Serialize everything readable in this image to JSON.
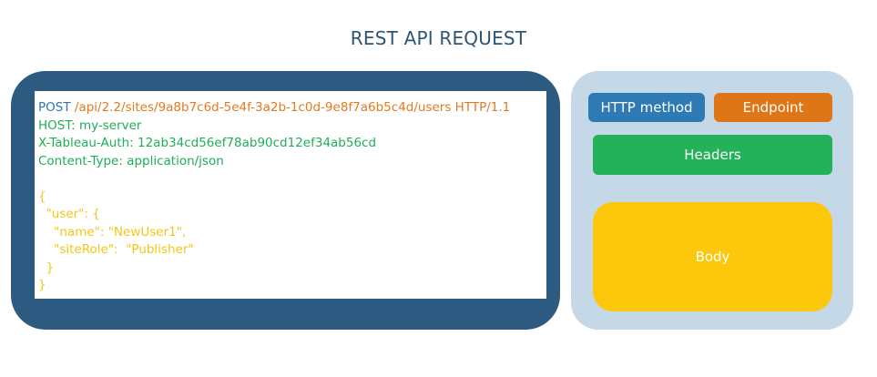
{
  "title": "REST API REQUEST",
  "request": {
    "method": "POST",
    "endpoint": "/api/2.2/sites/9a8b7c6d-5e4f-3a2b-1c0d-9e8f7a6b5c4d/users HTTP/1.1",
    "headers": [
      "HOST: my-server",
      "X-Tableau-Auth: 12ab34cd56ef78ab90cd12ef34ab56cd",
      "Content-Type: application/json"
    ],
    "body_lines": [
      "{",
      "  \"user\": {",
      "    \"name\": \"NewUser1\",",
      "    \"siteRole\":  \"Publisher\"",
      "  }",
      "}"
    ]
  },
  "legend": {
    "method_label": "HTTP method",
    "endpoint_label": "Endpoint",
    "headers_label": "Headers",
    "body_label": "Body"
  },
  "colors": {
    "method": "#2e75b6",
    "endpoint": "#e07b24",
    "headers": "#1fae57",
    "body": "#f3c616",
    "frame": "#2c5a80",
    "legend_frame": "#c5d8e8"
  }
}
